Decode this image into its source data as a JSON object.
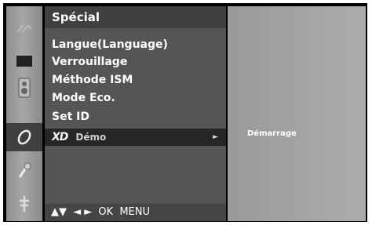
{
  "menu": {
    "title": "Spécial",
    "items": [
      {
        "label": "Langue(Language)"
      },
      {
        "label": "Verrouillage"
      },
      {
        "label": "Méthode ISM"
      },
      {
        "label": "Mode Eco."
      },
      {
        "label": "Set ID"
      }
    ],
    "selected": {
      "logo": "XD",
      "label": "Démo",
      "arrow": "►"
    }
  },
  "footer": {
    "updown": "▲▼",
    "leftright": "◄ ►",
    "ok": "OK",
    "menu": "MENU"
  },
  "submenu": {
    "item": "Démarrage"
  },
  "icons": [
    "picture-icon",
    "screen-icon",
    "speaker-icon",
    "time-icon",
    "option-icon",
    "special-icon"
  ]
}
